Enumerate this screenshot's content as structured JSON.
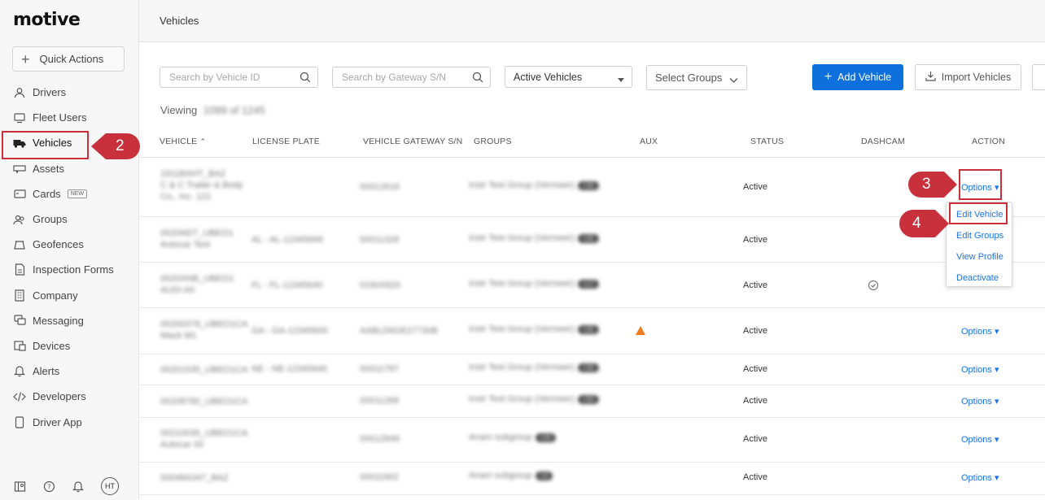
{
  "app": {
    "logo": "motive"
  },
  "sidebar": {
    "quick_actions": "Quick Actions",
    "items": [
      {
        "label": "Drivers",
        "icon": "person-icon"
      },
      {
        "label": "Fleet Users",
        "icon": "monitor-icon"
      },
      {
        "label": "Vehicles",
        "icon": "truck-icon"
      },
      {
        "label": "Assets",
        "icon": "trailer-icon"
      },
      {
        "label": "Cards",
        "icon": "card-icon",
        "badge": "NEW"
      },
      {
        "label": "Groups",
        "icon": "group-icon"
      },
      {
        "label": "Geofences",
        "icon": "geofence-icon"
      },
      {
        "label": "Inspection Forms",
        "icon": "form-icon"
      },
      {
        "label": "Company",
        "icon": "building-icon"
      },
      {
        "label": "Messaging",
        "icon": "message-icon"
      },
      {
        "label": "Devices",
        "icon": "device-icon"
      },
      {
        "label": "Alerts",
        "icon": "bell-icon"
      },
      {
        "label": "Developers",
        "icon": "code-icon"
      },
      {
        "label": "Driver App",
        "icon": "phone-icon"
      }
    ],
    "avatar": "HT"
  },
  "header": {
    "title": "Vehicles"
  },
  "toolbar": {
    "search_vehicle_placeholder": "Search by Vehicle ID",
    "search_gateway_placeholder": "Search by Gateway S/N",
    "status_filter": "Active Vehicles",
    "groups_filter": "Select Groups",
    "add_vehicle": "Add Vehicle",
    "import_vehicles": "Import Vehicles"
  },
  "viewing": {
    "label": "Viewing",
    "count": "1099 of 1245"
  },
  "table": {
    "columns": [
      "VEHICLE",
      "LICENSE PLATE",
      "VEHICLE GATEWAY S/N",
      "GROUPS",
      "AUX",
      "STATUS",
      "DASHCAM",
      "ACTION"
    ],
    "rows": [
      {
        "vehicle": [
          "1911BAHT_BAZ",
          "C & C Trailer & Body",
          "Co., Inc. 121"
        ],
        "plate": "",
        "gateway": "00012616",
        "group": "Instr Test Group (Vermeer)",
        "count": "+35",
        "status": "Active",
        "action": "Options ▾"
      },
      {
        "vehicle": [
          "0020ND7_UBEO1",
          "Autocar Test"
        ],
        "plate": "AL - AL-12345666",
        "gateway": "00011328",
        "group": "Instr Test Group (Vermeer)",
        "count": "+35",
        "status": "Active",
        "action": ""
      },
      {
        "vehicle": [
          "0020XNB_UBEO1",
          "AUDI A5"
        ],
        "plate": "FL - FL-12345640",
        "gateway": "0190X820",
        "group": "Instr Test Group (Vermeer)",
        "count": "+17",
        "status": "Active",
        "action": ""
      },
      {
        "vehicle": [
          "00200378_UBEO1CA",
          "Mack M1"
        ],
        "plate": "GA - GA-12345600",
        "gateway": "AABLD6GE27730B",
        "group": "Instr Test Group (Vermeer)",
        "count": "+35",
        "status": "Active",
        "action": "Options ▾"
      },
      {
        "vehicle": [
          "00201535_UBEO1CA"
        ],
        "plate": "NE - NE-12345640",
        "gateway": "00011787",
        "group": "Instr Test Group (Vermeer)",
        "count": "+35",
        "status": "Active",
        "action": "Options ▾"
      },
      {
        "vehicle": [
          "00208780_UBEO1CA"
        ],
        "plate": "",
        "gateway": "00011268",
        "group": "Instr Test Group (Vermeer)",
        "count": "+35",
        "status": "Active",
        "action": "Options ▾"
      },
      {
        "vehicle": [
          "00210035_UBEO1CA",
          "Autocar 00"
        ],
        "plate": "",
        "gateway": "00012846",
        "group": "Anam subgroup",
        "count": "+35",
        "status": "Active",
        "action": "Options ▾"
      },
      {
        "vehicle": [
          "00048A347_BAZ"
        ],
        "plate": "",
        "gateway": "00011902",
        "group": "Anam subgroup",
        "count": "+9",
        "status": "Active",
        "action": "Options ▾"
      }
    ]
  },
  "dropdown_menu": {
    "items": [
      "Edit Vehicle",
      "Edit Groups",
      "View Profile",
      "Deactivate"
    ]
  },
  "annotations": {
    "step2": "2",
    "step3": "3",
    "step4": "4"
  },
  "colors": {
    "accent": "#0e70dc",
    "callout": "#c8313c",
    "link": "#1a73e8",
    "warning": "#f07b1e"
  }
}
